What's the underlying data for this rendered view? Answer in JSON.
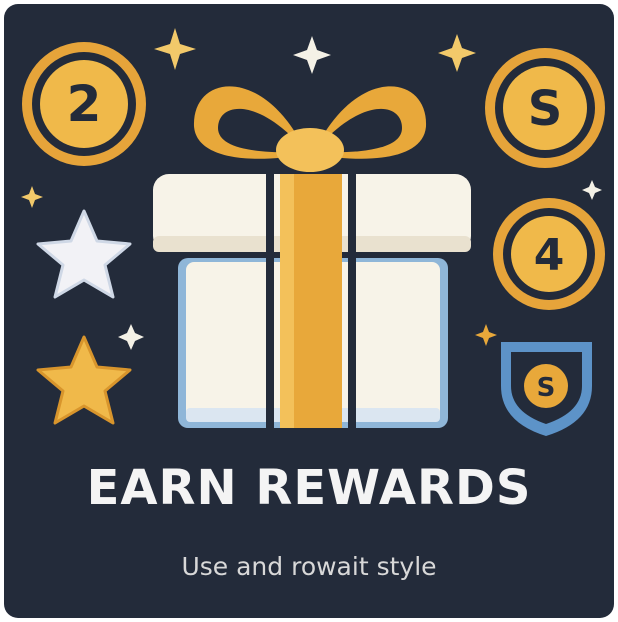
{
  "title": "EARN REWARDS",
  "subtitle": "Use and rowait style",
  "coins": [
    {
      "glyph": "2"
    },
    {
      "glyph": "S"
    },
    {
      "glyph": "4"
    }
  ],
  "badge": {
    "glyph": "S"
  },
  "colors": {
    "background": "#232b3a",
    "gold": "#e8a83a",
    "gold_light": "#f3c15a",
    "box_white": "#f7f3e8",
    "box_blue": "#8fb6d8",
    "star_white": "#f2f2f6",
    "badge_blue": "#5d93c8"
  },
  "icons": [
    "gift-box-icon",
    "coin-icon",
    "star-icon",
    "sparkle-icon",
    "shield-badge-icon"
  ]
}
